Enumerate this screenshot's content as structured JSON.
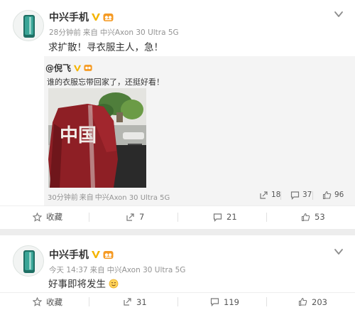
{
  "colors": {
    "accent": "#f39a1c",
    "verified": "#f4b400",
    "repost_bg": "#f4f4f4",
    "meta_text": "#939393",
    "separator": "#ededed"
  },
  "posts": [
    {
      "author": "中兴手机",
      "time": "28分钟前",
      "source_prefix": "来自",
      "source": "中兴Axon 30 Ultra 5G",
      "text": "求扩散！寻衣服主人，急！",
      "icons": {
        "avatar": "zte-phone-avatar",
        "verified": "verified-v-icon",
        "level": "level-badge-icon",
        "more": "chevron-down-icon"
      },
      "repost": {
        "author_prefix": "@",
        "author": "倪飞",
        "text": "谁的衣服忘带回家了，还挺好看！",
        "photo_text": "中国",
        "photo_subject": "red-china-jacket-on-chair",
        "time": "30分钟前",
        "source_prefix": "来自",
        "source": "中兴Axon 30 Ultra 5G",
        "stats": {
          "reposts": "18",
          "comments": "37",
          "likes": "96"
        }
      },
      "actions": {
        "favorite": "收藏",
        "repost": "7",
        "comment": "21",
        "like": "53"
      }
    },
    {
      "author": "中兴手机",
      "time": "今天 14:37",
      "source_prefix": "来自",
      "source": "中兴Axon 30 Ultra 5G",
      "text": "好事即将发生",
      "emoji": "smiling-face-emoji",
      "icons": {
        "avatar": "zte-phone-avatar",
        "verified": "verified-v-icon",
        "level": "level-badge-icon",
        "more": "chevron-down-icon"
      },
      "actions": {
        "favorite": "收藏",
        "repost": "31",
        "comment": "119",
        "like": "203"
      }
    }
  ]
}
